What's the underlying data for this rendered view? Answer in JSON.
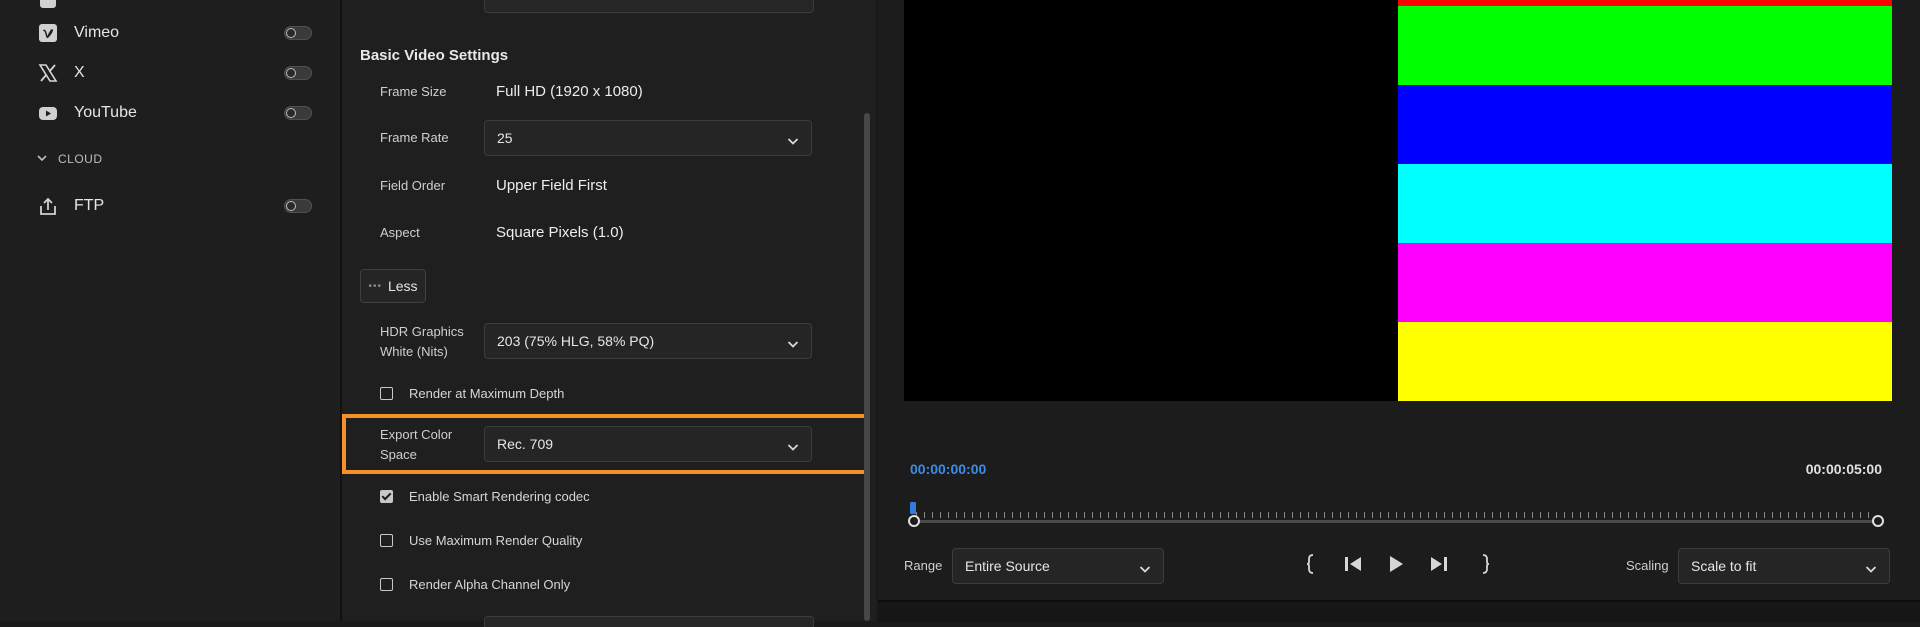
{
  "destinations": {
    "items": [
      {
        "label": "Vimeo",
        "icon": "vimeo-icon"
      },
      {
        "label": "X",
        "icon": "x-logo-icon"
      },
      {
        "label": "YouTube",
        "icon": "youtube-icon"
      }
    ],
    "cloud_section": "CLOUD",
    "cloud_items": [
      {
        "label": "FTP",
        "icon": "upload-icon"
      }
    ]
  },
  "settings": {
    "section_title": "Basic Video Settings",
    "frame_size_label": "Frame Size",
    "frame_size_value": "Full HD (1920 x 1080)",
    "frame_rate_label": "Frame Rate",
    "frame_rate_value": "25",
    "field_order_label": "Field Order",
    "field_order_value": "Upper Field First",
    "aspect_label": "Aspect",
    "aspect_value": "Square Pixels (1.0)",
    "less_button": "Less",
    "hdr_label_line1": "HDR Graphics",
    "hdr_label_line2": "White (Nits)",
    "hdr_value": "203 (75% HLG, 58% PQ)",
    "render_max_depth": "Render at Maximum Depth",
    "render_max_depth_checked": false,
    "export_color_label_line1": "Export Color",
    "export_color_label_line2": "Space",
    "export_color_value": "Rec. 709",
    "smart_rendering": "Enable Smart Rendering codec",
    "smart_rendering_checked": true,
    "max_render_quality": "Use Maximum Render Quality",
    "max_render_quality_checked": false,
    "alpha_only": "Render Alpha Channel Only",
    "alpha_only_checked": false
  },
  "preview": {
    "color_bars": [
      "#00ff00",
      "#0000ff",
      "#00ffff",
      "#ff00ff",
      "#ffff00"
    ],
    "top_sliver_color": "#ff0000",
    "timecode_start": "00:00:00:00",
    "timecode_end": "00:00:05:00",
    "timecode_start_color": "#3b8de8",
    "range_label": "Range",
    "range_value": "Entire Source",
    "scaling_label": "Scaling",
    "scaling_value": "Scale to fit"
  },
  "colors": {
    "highlight": "#f5912a",
    "playhead": "#2f7de1"
  }
}
